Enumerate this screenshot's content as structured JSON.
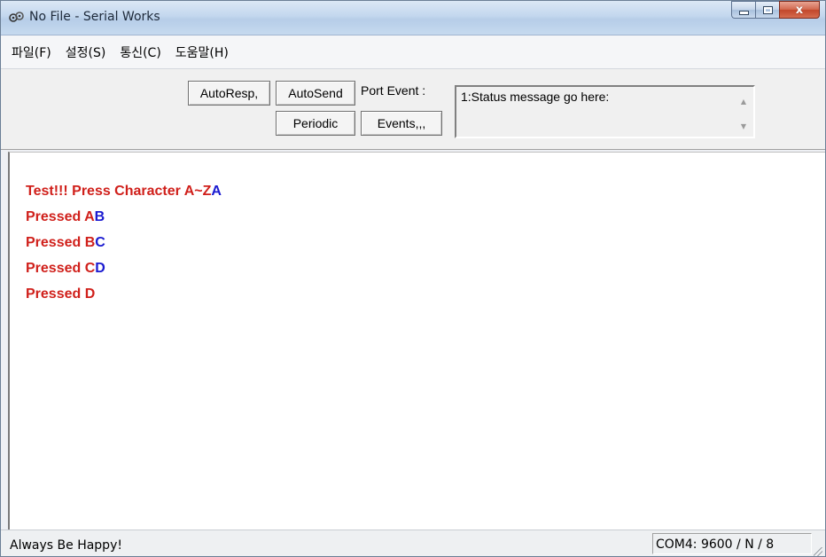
{
  "window": {
    "title": "No File - Serial Works",
    "close_glyph": "x",
    "icon": "serial-works-app-icon"
  },
  "menu": [
    {
      "label": "파일(F)"
    },
    {
      "label": "설정(S)"
    },
    {
      "label": "통신(C)"
    },
    {
      "label": "도움말(H)"
    }
  ],
  "toolbar": {
    "autoresp_label": "AutoResp,",
    "autosend_label": "AutoSend",
    "periodic_label": "Periodic",
    "events_label": "Events,,,",
    "port_event_label": "Port Event :",
    "status_message": "1:Status message go here:"
  },
  "terminal": {
    "colors": {
      "sent": "#d0201b",
      "received": "#1a1ad0"
    },
    "lines": [
      {
        "sent": "Test!!! Press Character A~Z",
        "received": "A"
      },
      {
        "sent": "Pressed A",
        "received": "B"
      },
      {
        "sent": "Pressed B",
        "received": "C"
      },
      {
        "sent": "Pressed C",
        "received": "D"
      },
      {
        "sent": "Pressed D",
        "received": ""
      }
    ]
  },
  "statusbar": {
    "left_text": "Always Be Happy!",
    "port_info": "COM4: 9600 / N / 8"
  }
}
